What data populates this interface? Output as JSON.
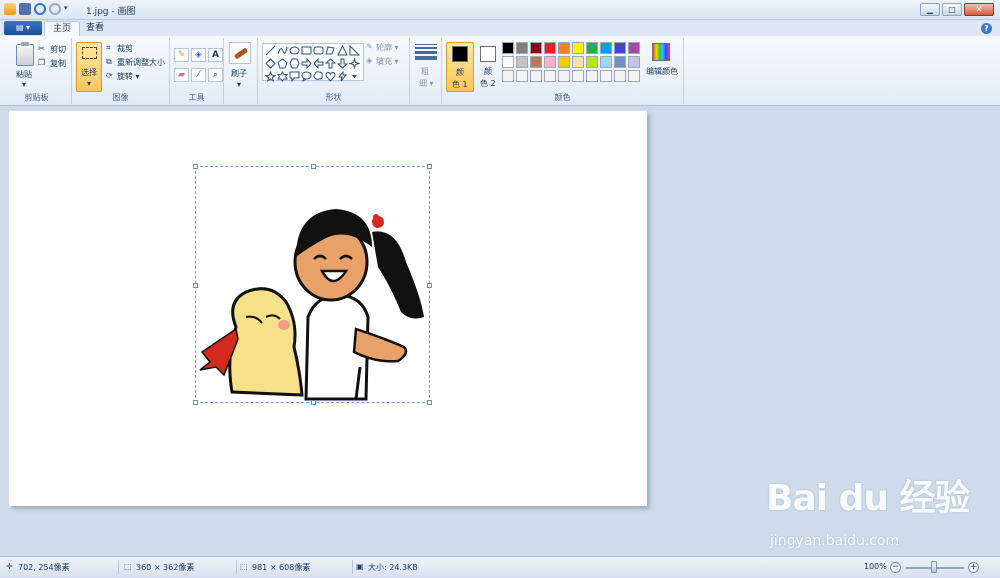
{
  "window": {
    "title": "1.jpg - 画图",
    "minimize": "▁",
    "maximize": "□",
    "close": "✕"
  },
  "tabs": [
    {
      "label": "主页",
      "active": true
    },
    {
      "label": "查看",
      "active": false
    }
  ],
  "app_menu_label": "▤ ▾",
  "help_label": "?",
  "ribbon": {
    "clipboard": {
      "group_label": "剪贴板",
      "paste": "粘贴",
      "cut": "剪切",
      "copy": "复制"
    },
    "image": {
      "group_label": "图像",
      "select": "选择",
      "crop": "裁剪",
      "resize": "重新调整大小",
      "rotate": "旋转 ▾"
    },
    "tools": {
      "group_label": "工具",
      "text_tool": "A"
    },
    "brushes": {
      "label": "刷子"
    },
    "shapes": {
      "group_label": "形状",
      "outline": "轮廓 ▾",
      "fill": "填充 ▾"
    },
    "size": {
      "label_line1": "粗",
      "label_line2": "细 ▾"
    },
    "colors": {
      "group_label": "颜色",
      "color1_line1": "颜",
      "color1_line2": "色 1",
      "color2_line1": "颜",
      "color2_line2": "色 2",
      "color1_value": "#000000",
      "color2_value": "#ffffff",
      "edit_colors": "编辑颜色",
      "palette": [
        "#000000",
        "#7f7f7f",
        "#880015",
        "#ed1c24",
        "#ff7f27",
        "#fff200",
        "#22b14c",
        "#00a2e8",
        "#3f48cc",
        "#a349a4",
        "#ffffff",
        "#c3c3c3",
        "#b97a57",
        "#ffaec9",
        "#ffc90e",
        "#efe4b0",
        "#b5e61d",
        "#99d9ea",
        "#7092be",
        "#c8bfe7",
        "#f4f4f4",
        "#f4f4f4",
        "#f4f4f4",
        "#f4f4f4",
        "#f4f4f4",
        "#f4f4f4",
        "#f4f4f4",
        "#f4f4f4",
        "#f4f4f4",
        "#f4f4f4"
      ]
    }
  },
  "status": {
    "cursor_pos": "702, 254像素",
    "selection_size": "360 × 362像素",
    "image_size": "981 × 608像素",
    "file_size": "大小: 24.3KB",
    "zoom": "100%",
    "zoom_out": "−",
    "zoom_in": "+"
  },
  "watermark": {
    "logo": "Bai du 经验",
    "url": "jingyan.baidu.com"
  }
}
